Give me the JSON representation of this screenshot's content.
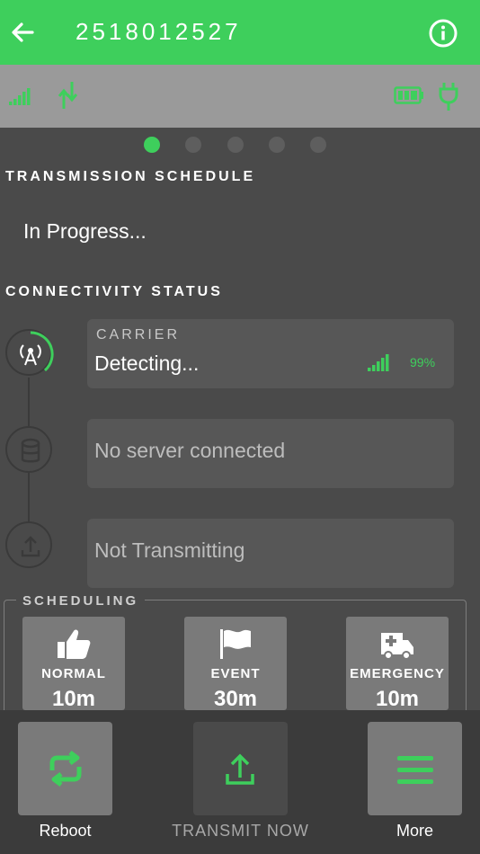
{
  "header": {
    "title": "2518012527",
    "back_icon": "arrow-left-icon",
    "info_icon": "info-icon"
  },
  "status_bar": {
    "icons": [
      "signal-bars-icon",
      "data-transfer-icon",
      "battery-icon",
      "power-plug-icon"
    ]
  },
  "pager": {
    "pages": 5,
    "active": 0
  },
  "transmission": {
    "title": "TRANSMISSION SCHEDULE",
    "status": "In Progress..."
  },
  "connectivity": {
    "title": "CONNECTIVITY STATUS",
    "carrier": {
      "label": "CARRIER",
      "value": "Detecting...",
      "signal_percent": "99%"
    },
    "server": {
      "value": "No server connected"
    },
    "transmit": {
      "value": "Not Transmitting"
    }
  },
  "scheduling": {
    "title": "SCHEDULING",
    "buttons": [
      {
        "name": "NORMAL",
        "time": "10m",
        "icon": "thumbs-up-icon"
      },
      {
        "name": "EVENT",
        "time": "30m",
        "icon": "flag-icon"
      },
      {
        "name": "EMERGENCY",
        "time": "10m",
        "icon": "ambulance-icon"
      }
    ]
  },
  "bottom_bar": {
    "reboot": {
      "label": "Reboot",
      "icon": "repeat-icon"
    },
    "transmit_now": {
      "label": "TRANSMIT NOW",
      "icon": "upload-icon"
    },
    "more": {
      "label": "More",
      "icon": "menu-icon"
    }
  },
  "colors": {
    "accent": "#3ecf5c",
    "background": "#4a4a4a",
    "card": "#575757",
    "statusbar": "#9a9a9a",
    "bottombar": "#3b3b3b"
  }
}
